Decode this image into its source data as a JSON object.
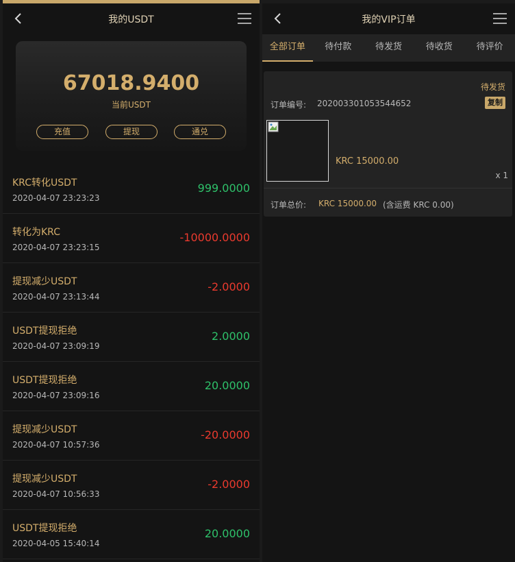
{
  "left": {
    "title": "我的USDT",
    "balance": "67018.9400",
    "balance_label": "当前USDT",
    "buttons": {
      "recharge": "充值",
      "withdraw": "提现",
      "exchange": "通兑"
    },
    "records": [
      {
        "title": "KRC转化USDT",
        "time": "2020-04-07 23:23:23",
        "amount": "999.0000",
        "sign": "pos"
      },
      {
        "title": "转化为KRC",
        "time": "2020-04-07 23:23:15",
        "amount": "-10000.0000",
        "sign": "neg"
      },
      {
        "title": "提现减少USDT",
        "time": "2020-04-07 23:13:44",
        "amount": "-2.0000",
        "sign": "neg"
      },
      {
        "title": "USDT提现拒绝",
        "time": "2020-04-07 23:09:19",
        "amount": "2.0000",
        "sign": "pos"
      },
      {
        "title": "USDT提现拒绝",
        "time": "2020-04-07 23:09:16",
        "amount": "20.0000",
        "sign": "pos"
      },
      {
        "title": "提现减少USDT",
        "time": "2020-04-07 10:57:36",
        "amount": "-20.0000",
        "sign": "neg"
      },
      {
        "title": "提现减少USDT",
        "time": "2020-04-07 10:56:33",
        "amount": "-2.0000",
        "sign": "neg"
      },
      {
        "title": "USDT提现拒绝",
        "time": "2020-04-05 15:40:14",
        "amount": "20.0000",
        "sign": "pos"
      }
    ]
  },
  "right": {
    "title": "我的VIP订单",
    "tabs": [
      "全部订单",
      "待付款",
      "待发货",
      "待收货",
      "待评价"
    ],
    "order": {
      "status": "待发货",
      "order_no_label": "订单编号:",
      "order_no": "202003301053544652",
      "copy_label": "复制",
      "price": "KRC 15000.00",
      "qty": "x 1",
      "total_label": "订单总价:",
      "total_amount": "KRC 15000.00",
      "total_shipping": "(含运费 KRC 0.00)"
    }
  },
  "colors": {
    "accent": "#d4ae6c",
    "positive": "#2ec16a",
    "negative": "#ea3a2e",
    "background": "#141414"
  }
}
